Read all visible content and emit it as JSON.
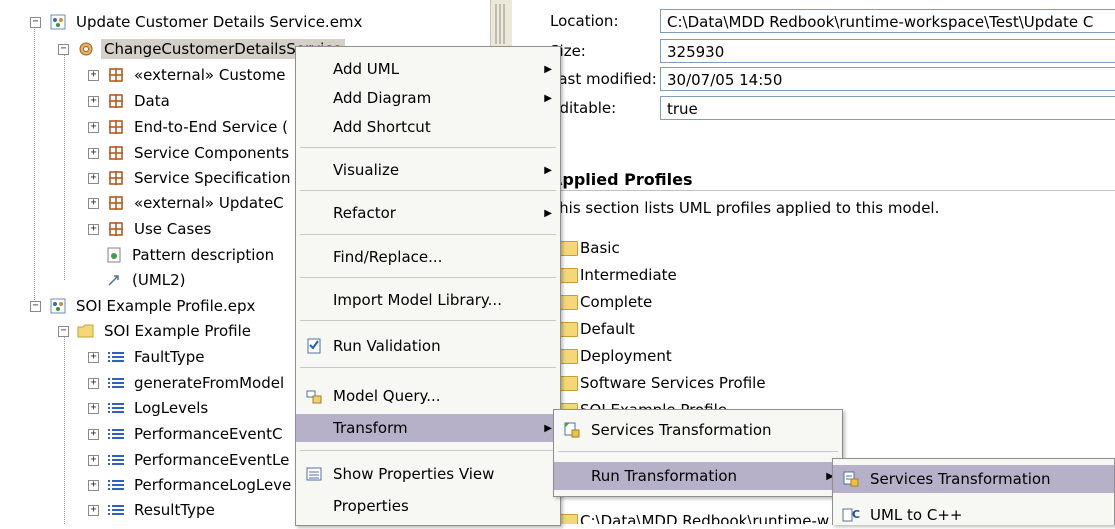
{
  "tree": {
    "items": [
      {
        "label": "Update Customer Details Service.emx",
        "icon": "model-file-icon",
        "toggle": "−"
      },
      {
        "label": "ChangeCustomerDetailsService",
        "icon": "gear-model-icon",
        "toggle": "−"
      },
      {
        "label": "«external» Custome",
        "icon": "package-icon",
        "toggle": "+"
      },
      {
        "label": "Data",
        "icon": "package-icon",
        "toggle": "+"
      },
      {
        "label": "End-to-End Service (",
        "icon": "package-icon",
        "toggle": "+"
      },
      {
        "label": "Service Components",
        "icon": "package-icon",
        "toggle": "+"
      },
      {
        "label": "Service Specification",
        "icon": "package-icon",
        "toggle": "+"
      },
      {
        "label": "«external» UpdateC",
        "icon": "package-icon",
        "toggle": "+"
      },
      {
        "label": "Use Cases",
        "icon": "package-icon",
        "toggle": "+"
      },
      {
        "label": "Pattern description",
        "icon": "document-icon",
        "toggle": ""
      },
      {
        "label": "(UML2)",
        "icon": "diagram-link-icon",
        "toggle": ""
      },
      {
        "label": "SOI Example Profile.epx",
        "icon": "profile-file-icon",
        "toggle": "−"
      },
      {
        "label": "SOI Example Profile",
        "icon": "folder-icon",
        "toggle": "−"
      },
      {
        "label": "FaultType",
        "icon": "enumeration-icon",
        "toggle": "+"
      },
      {
        "label": "generateFromModel",
        "icon": "enumeration-icon",
        "toggle": "+"
      },
      {
        "label": "LogLevels",
        "icon": "enumeration-icon",
        "toggle": "+"
      },
      {
        "label": "PerformanceEventC",
        "icon": "enumeration-icon",
        "toggle": "+"
      },
      {
        "label": "PerformanceEventLe",
        "icon": "enumeration-icon",
        "toggle": "+"
      },
      {
        "label": "PerformanceLogLeve",
        "icon": "enumeration-icon",
        "toggle": "+"
      },
      {
        "label": "ResultType",
        "icon": "enumeration-icon",
        "toggle": "+"
      }
    ]
  },
  "properties": {
    "location_label": "Location:",
    "location_value": "C:\\Data\\MDD Redbook\\runtime-workspace\\Test\\Update C",
    "size_label": "Size:",
    "size_value": "325930",
    "modified_label": "Last modified:",
    "modified_value": "30/07/05 14:50",
    "editable_label": "Editable:",
    "editable_value": "true",
    "profiles_heading": "Applied Profiles",
    "profiles_desc": "This section lists UML profiles applied to this model.",
    "profiles": [
      "Basic",
      "Intermediate",
      "Complete",
      "Default",
      "Deployment",
      "Software Services Profile",
      "SOI Example Profile"
    ],
    "bottom_path": "C:\\Data\\MDD Redbook\\runtime-w"
  },
  "context_menu": {
    "items": [
      {
        "label": "Add UML",
        "submenu": true
      },
      {
        "label": "Add Diagram",
        "submenu": true
      },
      {
        "label": "Add Shortcut",
        "submenu": false
      },
      {
        "label": "Visualize",
        "submenu": true
      },
      {
        "label": "Refactor",
        "submenu": true
      },
      {
        "label": "Find/Replace...",
        "submenu": false
      },
      {
        "label": "Import Model Library...",
        "submenu": false
      },
      {
        "label": "Run Validation",
        "submenu": false,
        "icon": "validation-icon"
      },
      {
        "label": "Model Query...",
        "submenu": false,
        "icon": "model-query-icon"
      },
      {
        "label": "Transform",
        "submenu": true,
        "highlighted": true
      },
      {
        "label": "Show Properties View",
        "submenu": false,
        "icon": "properties-view-icon"
      },
      {
        "label": "Properties",
        "submenu": false
      }
    ]
  },
  "transform_menu": {
    "items": [
      {
        "label": "Services Transformation",
        "icon": "transformation-icon"
      },
      {
        "label": "Run Transformation",
        "submenu": true,
        "highlighted": true
      }
    ]
  },
  "run_transformation_menu": {
    "items": [
      {
        "label": "Services Transformation",
        "icon": "transformation-icon",
        "highlighted": true
      },
      {
        "label": "UML to C++",
        "icon": "uml-cpp-icon"
      }
    ]
  },
  "colors": {
    "menu_highlight": "#b6b1c8",
    "package_icon": "#c0504d",
    "selection": "#d4d0c8"
  }
}
